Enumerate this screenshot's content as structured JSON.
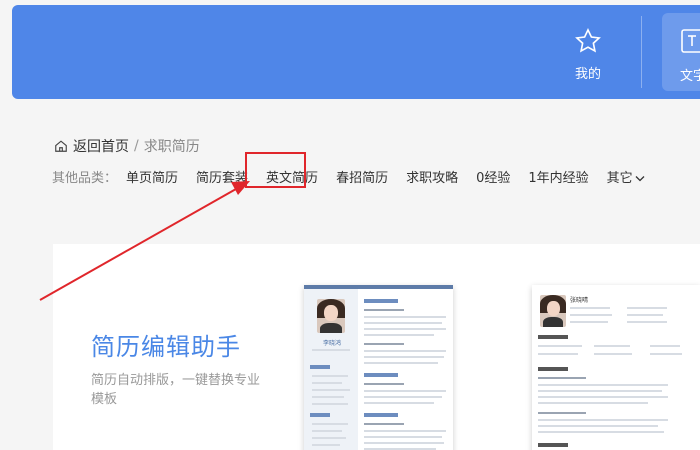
{
  "header": {
    "my_label": "我的",
    "doc_label": "文字"
  },
  "breadcrumb": {
    "home": "返回首页",
    "separator": "/",
    "current": "求职简历"
  },
  "categories": {
    "label": "其他品类：",
    "items": [
      {
        "label": "单页简历"
      },
      {
        "label": "简历套装"
      },
      {
        "label": "英文简历",
        "highlighted": true
      },
      {
        "label": "春招简历"
      },
      {
        "label": "求职攻略"
      },
      {
        "label": "0经验"
      },
      {
        "label": "1年内经验"
      },
      {
        "label": "其它"
      }
    ]
  },
  "card": {
    "title": "简历编辑助手",
    "description": "简历自动排版，一键替换专业模板"
  },
  "resume_preview_1": {
    "name": "李晓鸿"
  },
  "resume_preview_2": {
    "name": "张晓晴"
  },
  "colors": {
    "banner": "#4f86e8",
    "accent": "#4a87e6",
    "highlight_box": "#e0262b",
    "arrow": "#e0262b"
  },
  "icons": [
    "star-icon",
    "document-icon",
    "home-icon",
    "chevron-down-icon",
    "arrow-annotation"
  ]
}
